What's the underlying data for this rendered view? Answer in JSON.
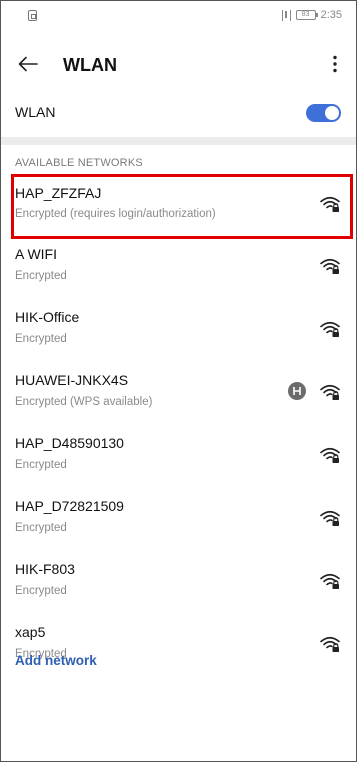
{
  "status_bar": {
    "time": "2:35",
    "battery": "83"
  },
  "header": {
    "title": "WLAN"
  },
  "wlan_toggle": {
    "label": "WLAN",
    "enabled": true,
    "accent_color": "#3f6fd9"
  },
  "section": {
    "title": "AVAILABLE NETWORKS"
  },
  "networks": [
    {
      "name": "HAP_ZFZFAJ",
      "status": "Encrypted (requires login/authorization)",
      "highlighted": true
    },
    {
      "name": "A WIFI",
      "status": "Encrypted"
    },
    {
      "name": "HIK-Office",
      "status": "Encrypted"
    },
    {
      "name": "HUAWEI-JNKX4S",
      "status": "Encrypted (WPS available)",
      "wps": true
    },
    {
      "name": "HAP_D48590130",
      "status": "Encrypted"
    },
    {
      "name": "HAP_D72821509",
      "status": "Encrypted"
    },
    {
      "name": "HIK-F803",
      "status": "Encrypted"
    },
    {
      "name": "xap5",
      "status": "Encrypted"
    }
  ],
  "add_network": {
    "label": "Add network"
  },
  "icons": {
    "back": "back-arrow-icon",
    "more": "more-vert-icon",
    "wifi": "wifi-locked-icon",
    "wps": "wps-icon"
  }
}
